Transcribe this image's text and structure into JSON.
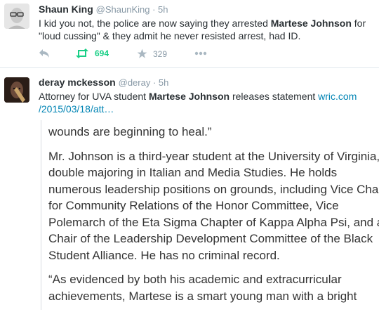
{
  "tweet1": {
    "name": "Shaun King",
    "handle": "@ShaunKing",
    "sep": " · ",
    "time": "5h",
    "text_a": "I kid you not, the police are now saying they arrested ",
    "text_b": "Martese Johnson",
    "text_c": " for \"loud cussing\" & they admit he never resisted arrest, had ID.",
    "retweets": "694",
    "favorites": "329",
    "icons": [
      "reply-icon",
      "retweet-icon",
      "favorite-icon",
      "more-icon"
    ],
    "colors": {
      "retweet": "#19cf86",
      "muted": "#aab8c2"
    }
  },
  "tweet2": {
    "name": "deray mckesson",
    "handle": "@deray",
    "sep": " · ",
    "time": "5h",
    "text_a": "Attorney for UVA student ",
    "text_b": "Martese Johnson",
    "text_c": " releases statement ",
    "link": "wric.com /2015/03/18/att…",
    "colors": {
      "link": "#0084b4"
    }
  },
  "article": {
    "p1": "wounds are beginning to heal.”",
    "p2": "Mr. Johnson is a third-year student at the University of Virginia, double majoring in Italian and Media Studies. He holds numerous leadership positions on grounds, including Vice Chair for Community Relations of the Honor Committee, Vice Polemarch of the Eta Sigma Chapter of Kappa Alpha Psi, and a Chair of the Leadership Development Committee of the Black Student Alliance. He has no criminal record.",
    "p3": "“As evidenced by both his academic and extracurricular achievements, Martese is a smart young man with a bright"
  }
}
